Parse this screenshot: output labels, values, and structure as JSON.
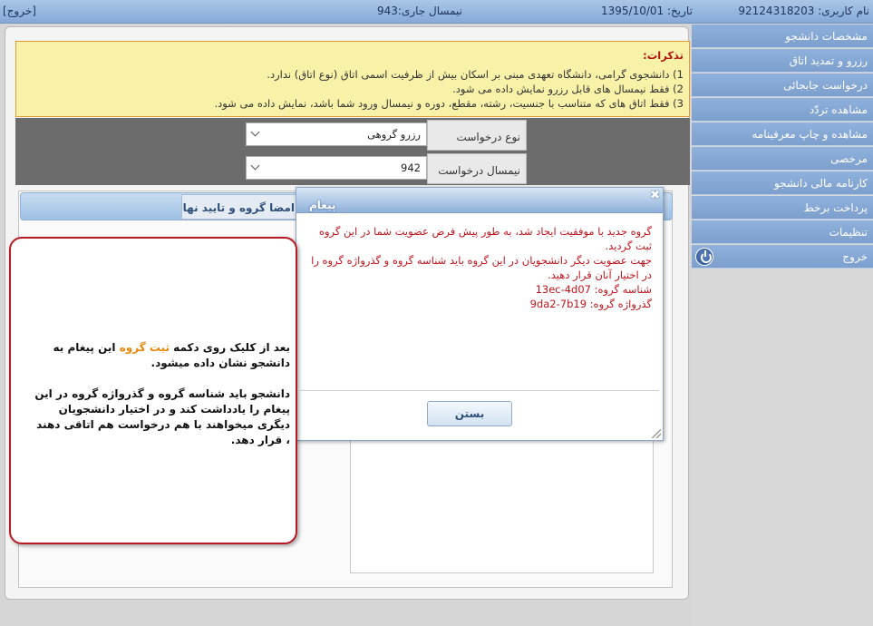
{
  "topbar": {
    "user": "نام کاربری: 92124318203",
    "date": "تاریخ: 1395/10/01",
    "term": "نیمسال جاری:943",
    "exit": "[خروج]"
  },
  "sidebar": {
    "items": [
      {
        "label": "مشخصات دانشجو"
      },
      {
        "label": "رزرو و تمدید اتاق"
      },
      {
        "label": "درخواست جابجائی"
      },
      {
        "label": "مشاهده تردّد"
      },
      {
        "label": "مشاهده و چاپ معرفینامه"
      },
      {
        "label": "مرخصی"
      },
      {
        "label": "کارنامه مالی دانشجو"
      },
      {
        "label": "پرداخت برخط"
      },
      {
        "label": "تنظیمات"
      },
      {
        "label": "خروج",
        "icon": "power-icon"
      }
    ]
  },
  "notes": {
    "title": "تذکرات:",
    "lines": [
      "1) دانشجوی گرامی، دانشگاه تعهدی مبنی بر اسکان بیش از ظرفیت اسمی اتاق (نوع اتاق) ندارد.",
      "2) فقط نیمسال های قابل رزرو نمایش داده می شود.",
      "3) فقط اتاق های که متناسب با جنسیت، رشته، مقطع، دوره و نیمسال ورود شما باشد، نمایش داده می شود."
    ]
  },
  "filters": {
    "request_type_label": "نوع درخواست",
    "request_type_value": "رزرو گروهی",
    "term_label": "نیمسال درخواست",
    "term_value": "942"
  },
  "group": {
    "tab_label": "امضا گروه و تایید نهایی"
  },
  "dialog": {
    "title": "پیغام",
    "close_symbol": "✖",
    "lines": [
      "گروه جدید با موفقیت ایجاد شد، به طور پیش فرض عضویت شما در این گروه ثبت گردید.",
      "جهت عضویت دیگر دانشجویان در این گروه باید شناسه گروه و گذرواژه گروه را در اختیار آنان قرار دهید.",
      "شناسه گروه: 13ec-4d07",
      "گذرواژه گروه: 9da2-7b19"
    ],
    "close_button": "بستن"
  },
  "callout": {
    "p1_before": "بعد از کلیک روی دکمه ",
    "p1_highlight": "ثبت گروه",
    "p1_after": " این پیغام به دانشجو نشان داده میشود.",
    "p2": "دانشجو باید شناسه گروه و گذرواژه گروه در این پیغام را یادداشت کند و در اختیار دانشجویان دیگری میخواهند با هم درخواست هم اتاقی دهند ، قرار دهد."
  },
  "colors": {
    "accent": "#8fb1dc",
    "warning_bg": "#f8f2a9",
    "error_text": "#c0141b",
    "highlight": "#e4880a"
  }
}
